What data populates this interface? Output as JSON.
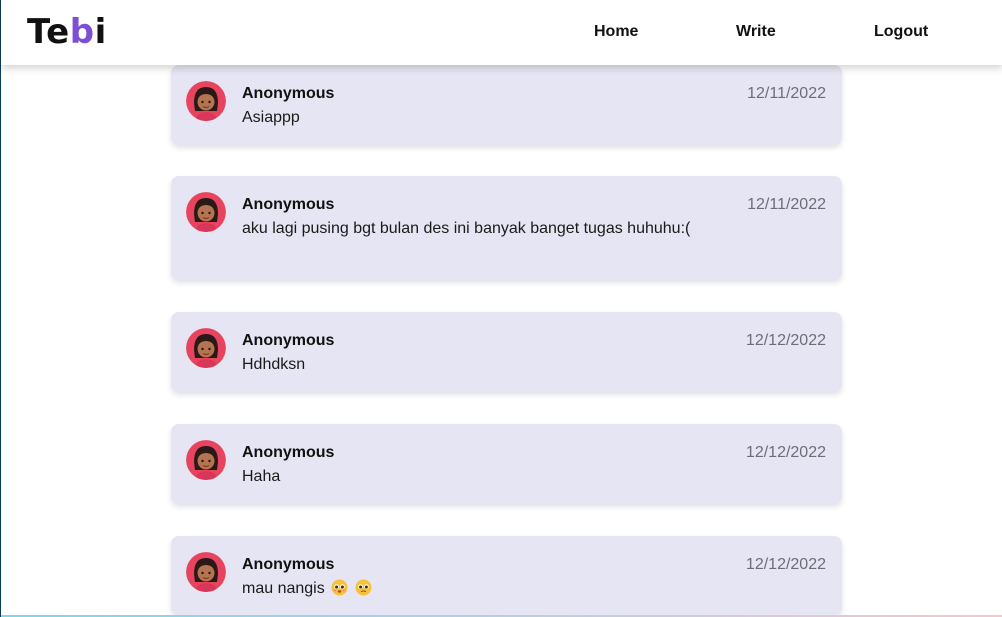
{
  "navbar": {
    "logo_prefix": "Te",
    "logo_accent": "b",
    "logo_suffix": "i",
    "links": [
      "Home",
      "Write",
      "Logout"
    ]
  },
  "colors": {
    "logo_accent": "#7b4fd6",
    "card_background": "#e6e5f3",
    "avatar_background": "#e8445f"
  },
  "posts": [
    {
      "author": "Anonymous",
      "date": "12/11/2022",
      "message": "Asiappp"
    },
    {
      "author": "Anonymous",
      "date": "12/11/2022",
      "message": "aku lagi pusing bgt bulan des ini banyak banget tugas huhuhu:("
    },
    {
      "author": "Anonymous",
      "date": "12/12/2022",
      "message": "Hdhdksn"
    },
    {
      "author": "Anonymous",
      "date": "12/12/2022",
      "message": "Haha"
    },
    {
      "author": "Anonymous",
      "date": "12/12/2022",
      "message": "mau nangis",
      "emojis": [
        "pleading-face-emoji",
        "pleading-face-emoji"
      ]
    }
  ]
}
